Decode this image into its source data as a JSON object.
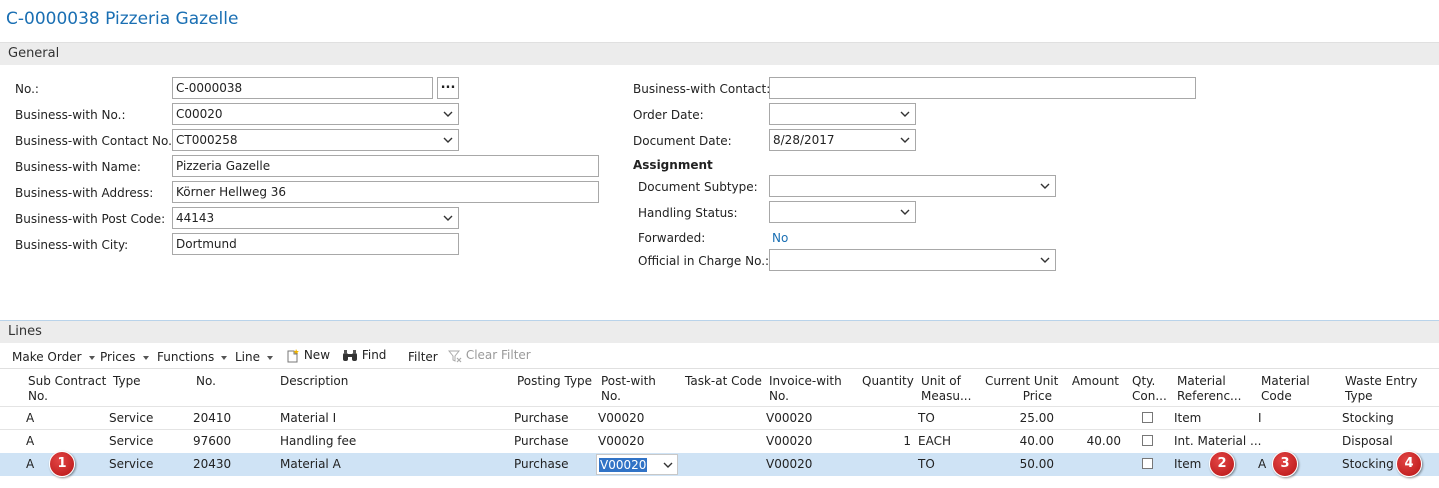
{
  "window": {
    "title": "C-0000038 Pizzeria Gazelle"
  },
  "general": {
    "section_title": "General",
    "left_fields": [
      {
        "label": "No.:",
        "value": "C-0000038",
        "kind": "assist",
        "assist_label": "..."
      },
      {
        "label": "Business-with No.:",
        "value": "C00020",
        "kind": "dropdown"
      },
      {
        "label": "Business-with Contact No.:",
        "value": "CT000258",
        "kind": "dropdown"
      },
      {
        "label": "Business-with Name:",
        "value": "Pizzeria Gazelle",
        "kind": "text"
      },
      {
        "label": "Business-with Address:",
        "value": "Körner Hellweg 36",
        "kind": "text"
      },
      {
        "label": "Business-with Post Code:",
        "value": "44143",
        "kind": "dropdown"
      },
      {
        "label": "Business-with City:",
        "value": "Dortmund",
        "kind": "text"
      }
    ],
    "right_fields": [
      {
        "label": "Business-with Contact:",
        "value": "",
        "kind": "text"
      },
      {
        "label": "Order Date:",
        "value": "",
        "kind": "dropdown"
      },
      {
        "label": "Document Date:",
        "value": "8/28/2017",
        "kind": "dropdown"
      }
    ],
    "assignment": {
      "heading": "Assignment",
      "fields": [
        {
          "label": "Document Subtype:",
          "value": "",
          "kind": "dropdown"
        },
        {
          "label": "Handling Status:",
          "value": "",
          "kind": "dropdown"
        },
        {
          "label": "Forwarded:",
          "value": "No",
          "kind": "link"
        },
        {
          "label": "Official in Charge No.:",
          "value": "",
          "kind": "dropdown"
        }
      ]
    }
  },
  "lines": {
    "section_title": "Lines",
    "toolbar": {
      "make_order": "Make Order",
      "prices": "Prices",
      "functions": "Functions",
      "line": "Line",
      "new": "New",
      "find": "Find",
      "filter": "Filter",
      "clear_filter": "Clear Filter"
    },
    "columns": [
      [
        "Sub Contract",
        "No."
      ],
      [
        "Type",
        ""
      ],
      [
        "No.",
        ""
      ],
      [
        "Description",
        ""
      ],
      [
        "Posting Type",
        ""
      ],
      [
        "Post-with",
        "No."
      ],
      [
        "Task-at Code",
        ""
      ],
      [
        "Invoice-with",
        "No."
      ],
      [
        "Quantity",
        ""
      ],
      [
        "Unit of",
        "Measu..."
      ],
      [
        "Current Unit",
        "Price"
      ],
      [
        "Amount",
        ""
      ],
      [
        "Qty.",
        "Con..."
      ],
      [
        "Material",
        "Referenc..."
      ],
      [
        "Material",
        "Code"
      ],
      [
        "Waste Entry",
        "Type"
      ]
    ],
    "rows": [
      {
        "sub_contract": "A",
        "type": "Service",
        "no": "20410",
        "description": "Material I",
        "posting_type": "Purchase",
        "post_with": "V00020",
        "task_at": "",
        "invoice_with": "V00020",
        "quantity": "",
        "uom": "TO",
        "unit_price": "25.00",
        "amount": "",
        "qty_con": false,
        "material_ref": "Item",
        "material_code": "I",
        "waste_type": "Stocking"
      },
      {
        "sub_contract": "A",
        "type": "Service",
        "no": "97600",
        "description": "Handling fee",
        "posting_type": "Purchase",
        "post_with": "V00020",
        "task_at": "",
        "invoice_with": "V00020",
        "quantity": "1",
        "uom": "EACH",
        "unit_price": "40.00",
        "amount": "40.00",
        "qty_con": false,
        "material_ref": "Int. Material ...",
        "material_code": "",
        "waste_type": "Disposal"
      },
      {
        "sub_contract": "A",
        "type": "Service",
        "no": "20430",
        "description": "Material A",
        "posting_type": "Purchase",
        "post_with": "V00020",
        "task_at": "",
        "invoice_with": "V00020",
        "quantity": "",
        "uom": "TO",
        "unit_price": "50.00",
        "amount": "",
        "qty_con": false,
        "material_ref": "Item",
        "material_code": "A",
        "waste_type": "Stocking"
      }
    ]
  },
  "callouts": [
    "1",
    "2",
    "3",
    "4"
  ],
  "colors": {
    "title": "#1a6fb3",
    "selected_row": "#cfe3f5",
    "badge": "#c81d1d",
    "link": "#1a6fb3"
  }
}
